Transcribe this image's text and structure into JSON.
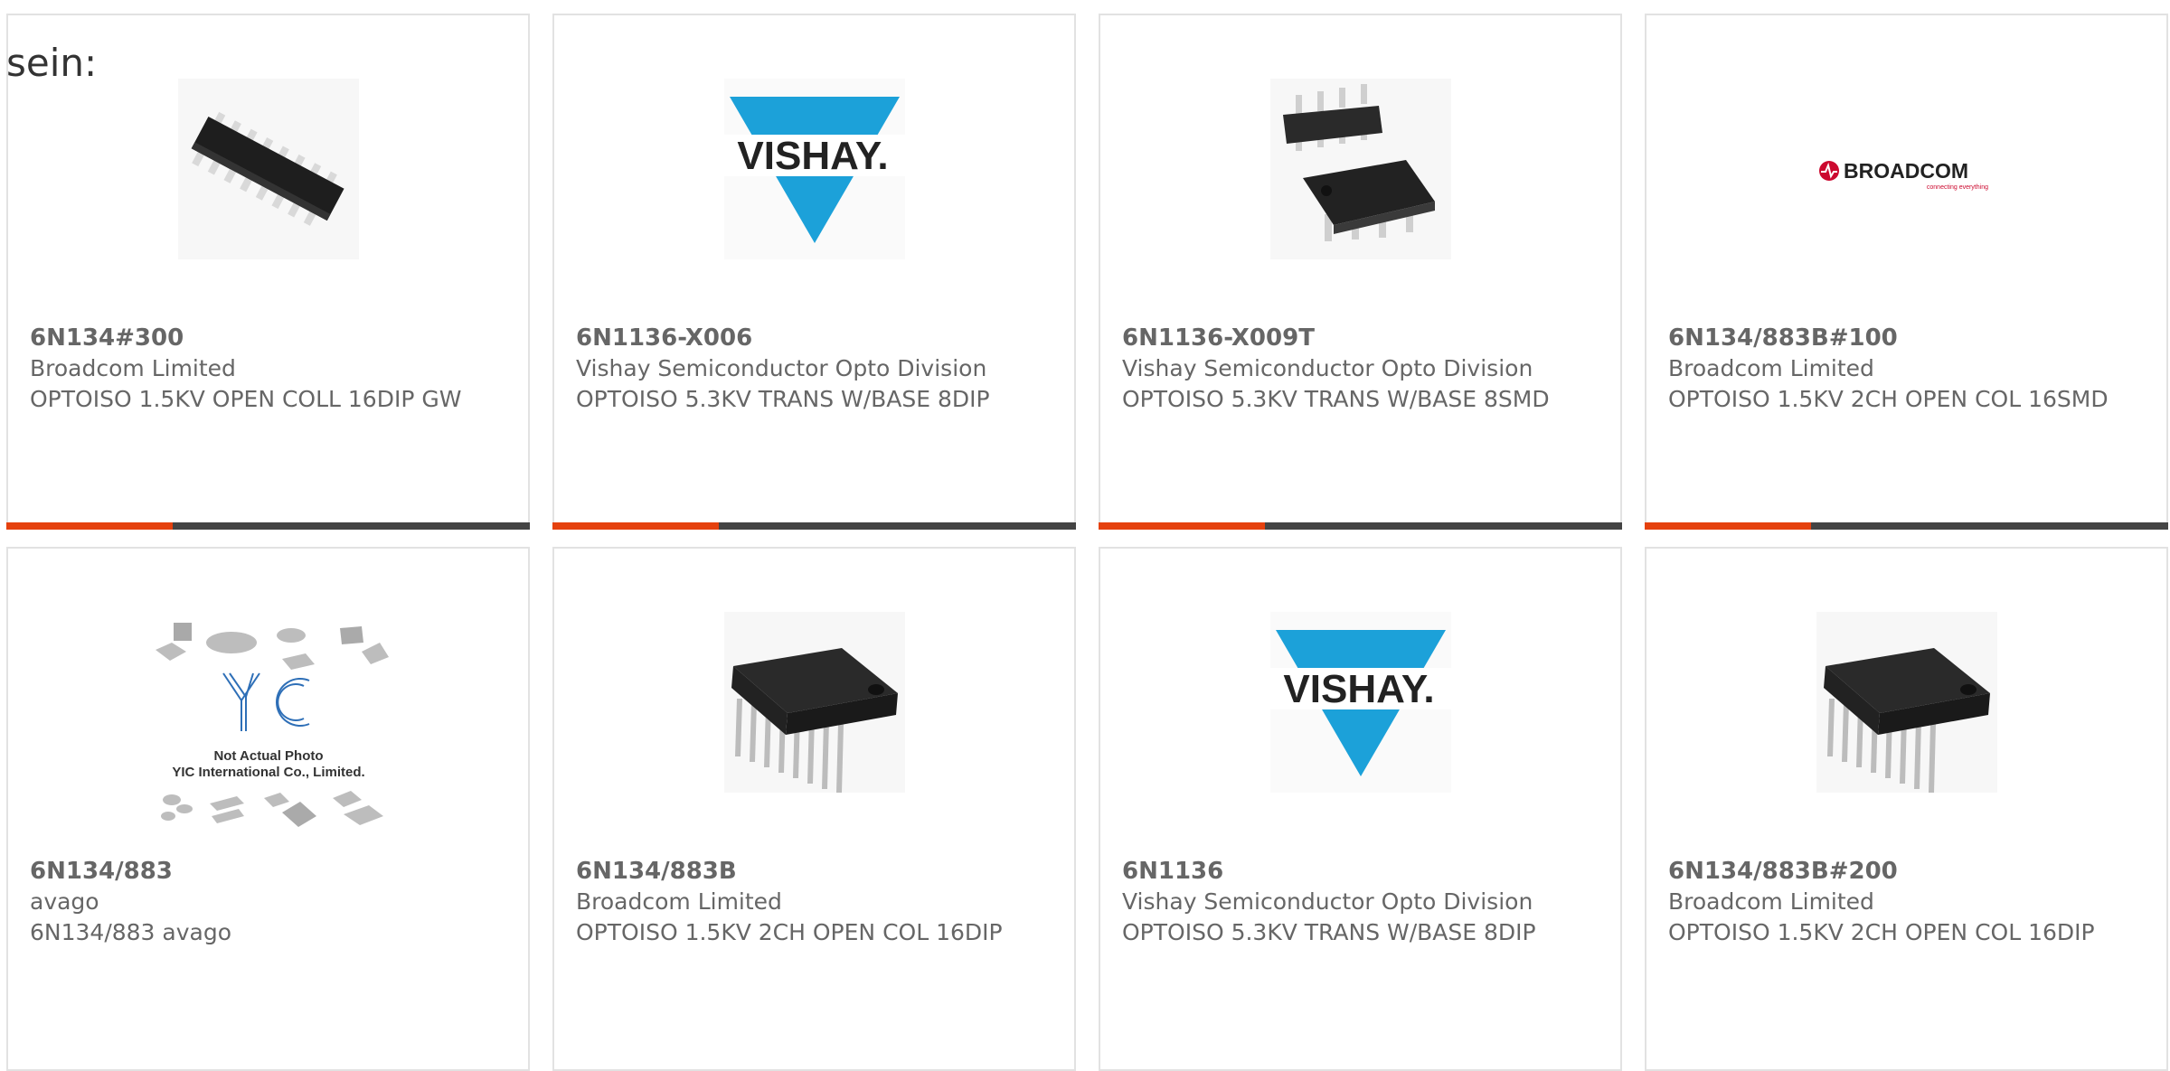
{
  "intro_text": "sein:",
  "colors": {
    "accent": "#e5410e",
    "bar": "#444444",
    "text": "#666666",
    "border": "#e2e2e2",
    "vishay_blue": "#1ca1d9",
    "broadcom_red": "#cc092f"
  },
  "products": [
    {
      "part": "6N134#300",
      "manufacturer": "Broadcom Limited",
      "description": "OPTOISO 1.5KV OPEN COLL 16DIP GW",
      "image": "dip16-chip-angled-icon"
    },
    {
      "part": "6N1136-X006",
      "manufacturer": "Vishay Semiconductor Opto Division",
      "description": "OPTOISO 5.3KV TRANS W/BASE 8DIP",
      "image": "vishay-logo",
      "logo_text": "VISHAY."
    },
    {
      "part": "6N1136-X009T",
      "manufacturer": "Vishay Semiconductor Opto Division",
      "description": "OPTOISO 5.3KV TRANS W/BASE 8SMD",
      "image": "dip8-chips-icon"
    },
    {
      "part": "6N134/883B#100",
      "manufacturer": "Broadcom Limited",
      "description": "OPTOISO 1.5KV 2CH OPEN COL 16SMD",
      "image": "broadcom-logo",
      "logo_text": "BROADCOM",
      "logo_tagline": "connecting everything"
    },
    {
      "part": "6N134/883",
      "manufacturer": "avago",
      "description": "6N134/883 avago",
      "image": "placeholder-photo",
      "placeholder_logo": "YIC",
      "placeholder_line1": "Not Actual Photo",
      "placeholder_line2": "YIC International Co., Limited."
    },
    {
      "part": "6N134/883B",
      "manufacturer": "Broadcom Limited",
      "description": "OPTOISO 1.5KV 2CH OPEN COL 16DIP",
      "image": "dip16-chip-icon"
    },
    {
      "part": "6N1136",
      "manufacturer": "Vishay Semiconductor Opto Division",
      "description": "OPTOISO 5.3KV TRANS W/BASE 8DIP",
      "image": "vishay-logo",
      "logo_text": "VISHAY."
    },
    {
      "part": "6N134/883B#200",
      "manufacturer": "Broadcom Limited",
      "description": "OPTOISO 1.5KV 2CH OPEN COL 16DIP",
      "image": "dip16-chip-icon"
    }
  ]
}
